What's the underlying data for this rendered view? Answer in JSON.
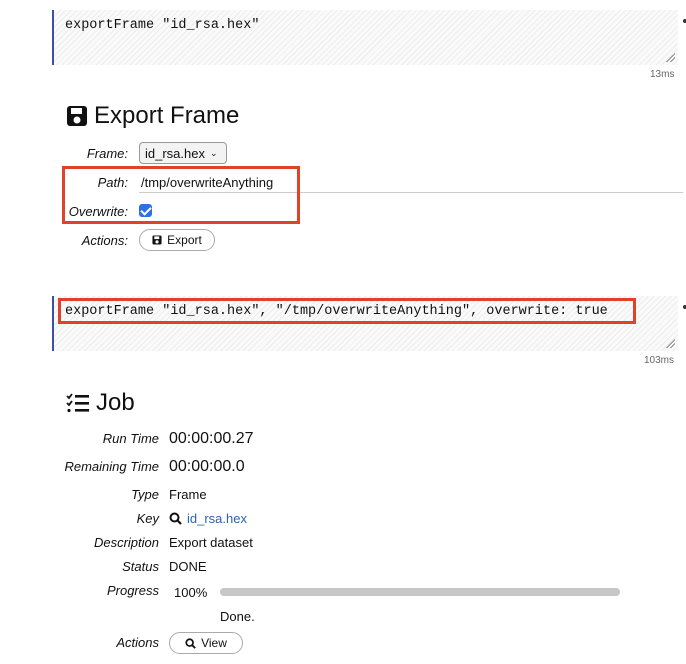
{
  "cell1": {
    "code": "exportFrame \"id_rsa.hex\"",
    "timing": "13ms"
  },
  "export_frame": {
    "title": "Export Frame",
    "frame_label": "Frame:",
    "frame_value": "id_rsa.hex",
    "path_label": "Path:",
    "path_value": "/tmp/overwriteAnything",
    "overwrite_label": "Overwrite:",
    "overwrite_checked": true,
    "actions_label": "Actions:",
    "export_button": "Export"
  },
  "cell2": {
    "code": "exportFrame \"id_rsa.hex\", \"/tmp/overwriteAnything\", overwrite: true",
    "timing": "103ms"
  },
  "job": {
    "title": "Job",
    "rows": {
      "run_time": {
        "label": "Run Time",
        "value": "00:00:00.27"
      },
      "remaining_time": {
        "label": "Remaining Time",
        "value": "00:00:00.0"
      },
      "type": {
        "label": "Type",
        "value": "Frame"
      },
      "key": {
        "label": "Key",
        "value": "id_rsa.hex"
      },
      "description": {
        "label": "Description",
        "value": "Export dataset"
      },
      "status": {
        "label": "Status",
        "value": "DONE"
      },
      "progress": {
        "label": "Progress",
        "value": "100%",
        "fraction": 1.0,
        "message": "Done."
      },
      "actions": {
        "label": "Actions",
        "view_button": "View"
      }
    }
  },
  "colors": {
    "highlight_box": "#e0412b",
    "link": "#2a64b4",
    "checkbox": "#2f6fe4",
    "cell_border": "#3d4fa0"
  }
}
